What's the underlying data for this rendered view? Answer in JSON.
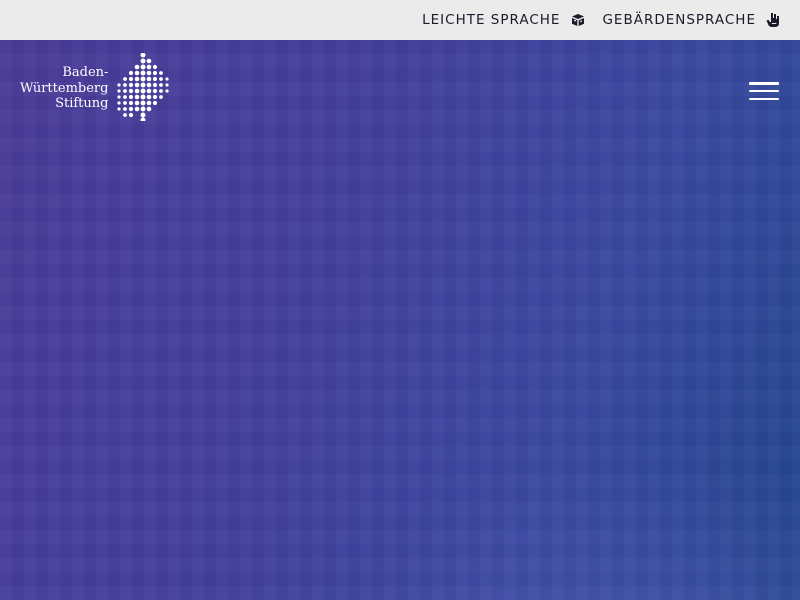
{
  "topbar": {
    "easy_language": {
      "label": "LEICHTE SPRACHE",
      "icon": "easy-language-icon"
    },
    "sign_language": {
      "label": "GEBÄRDENSPRACHE",
      "icon": "sign-language-hand-icon"
    }
  },
  "logo": {
    "line1": "Baden-",
    "line2": "Württemberg",
    "line3": "Stiftung",
    "icon": "dotted-foundation-mark"
  },
  "header": {
    "menu_icon": "hamburger-menu-icon"
  },
  "colors": {
    "topbar_bg": "#ebebeb",
    "topbar_text": "#1b1b2b",
    "hero_gradient_start": "#4a3b98",
    "hero_gradient_end": "#23468f",
    "logo_color": "#ffffff"
  }
}
